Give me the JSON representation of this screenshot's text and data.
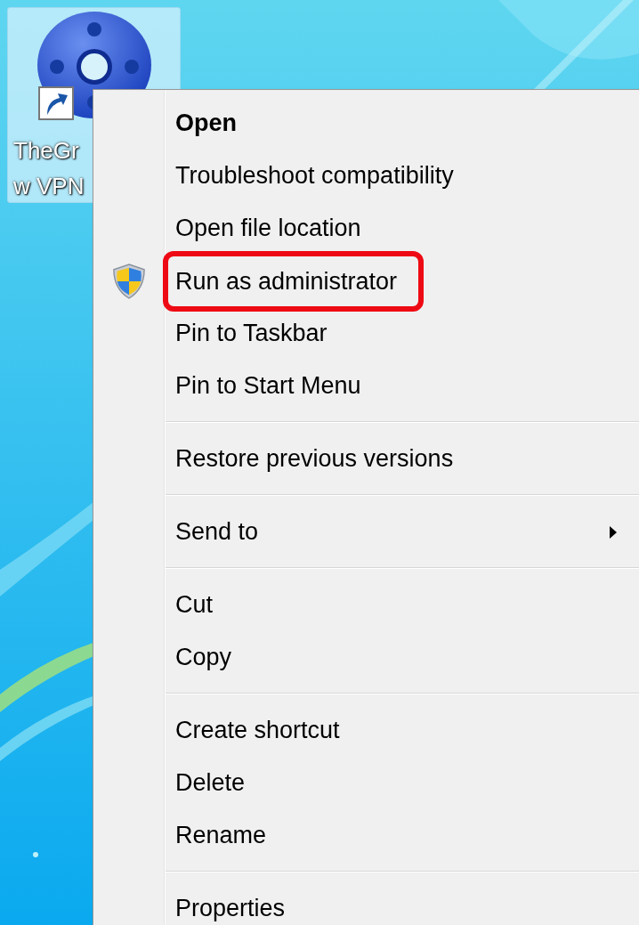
{
  "desktop_icon": {
    "label_lines": [
      "TheGr",
      "w VPN"
    ],
    "selected": true,
    "shortcut": true
  },
  "context_menu": {
    "items": [
      {
        "kind": "item",
        "label": "Open",
        "default": true,
        "highlighted": false,
        "submenu": false,
        "elevated": false
      },
      {
        "kind": "item",
        "label": "Troubleshoot compatibility",
        "default": false,
        "highlighted": false,
        "submenu": false,
        "elevated": false
      },
      {
        "kind": "item",
        "label": "Open file location",
        "default": false,
        "highlighted": false,
        "submenu": false,
        "elevated": false
      },
      {
        "kind": "item",
        "label": "Run as administrator",
        "default": false,
        "highlighted": true,
        "submenu": false,
        "elevated": true
      },
      {
        "kind": "item",
        "label": "Pin to Taskbar",
        "default": false,
        "highlighted": false,
        "submenu": false,
        "elevated": false
      },
      {
        "kind": "item",
        "label": "Pin to Start Menu",
        "default": false,
        "highlighted": false,
        "submenu": false,
        "elevated": false
      },
      {
        "kind": "separator"
      },
      {
        "kind": "item",
        "label": "Restore previous versions",
        "default": false,
        "highlighted": false,
        "submenu": false,
        "elevated": false
      },
      {
        "kind": "separator"
      },
      {
        "kind": "item",
        "label": "Send to",
        "default": false,
        "highlighted": false,
        "submenu": true,
        "elevated": false
      },
      {
        "kind": "separator"
      },
      {
        "kind": "item",
        "label": "Cut",
        "default": false,
        "highlighted": false,
        "submenu": false,
        "elevated": false
      },
      {
        "kind": "item",
        "label": "Copy",
        "default": false,
        "highlighted": false,
        "submenu": false,
        "elevated": false
      },
      {
        "kind": "separator"
      },
      {
        "kind": "item",
        "label": "Create shortcut",
        "default": false,
        "highlighted": false,
        "submenu": false,
        "elevated": false
      },
      {
        "kind": "item",
        "label": "Delete",
        "default": false,
        "highlighted": false,
        "submenu": false,
        "elevated": false
      },
      {
        "kind": "item",
        "label": "Rename",
        "default": false,
        "highlighted": false,
        "submenu": false,
        "elevated": false
      },
      {
        "kind": "separator"
      },
      {
        "kind": "item",
        "label": "Properties",
        "default": false,
        "highlighted": false,
        "submenu": false,
        "elevated": false
      }
    ]
  }
}
